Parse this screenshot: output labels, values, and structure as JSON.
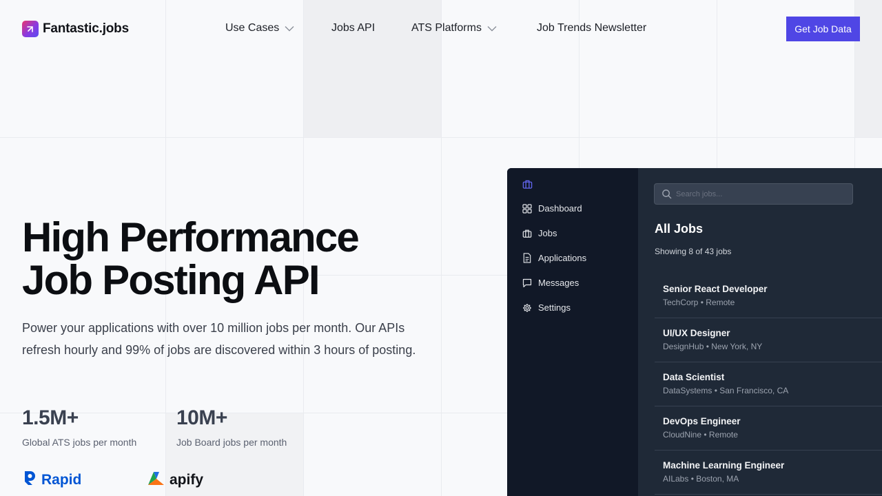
{
  "header": {
    "logo_text": "Fantastic.jobs",
    "nav": [
      {
        "label": "Use Cases",
        "has_dropdown": true
      },
      {
        "label": "Jobs API",
        "has_dropdown": false
      },
      {
        "label": "ATS Platforms",
        "has_dropdown": true
      },
      {
        "label": "Job Trends Newsletter",
        "has_dropdown": false
      }
    ],
    "cta_label": "Get Job Data"
  },
  "hero": {
    "title_line1": "High Performance",
    "title_line2": "Job Posting API",
    "description": "Power your applications with over 10 million jobs per month. Our APIs refresh hourly and 99% of jobs are discovered within 3 hours of posting.",
    "stats": [
      {
        "value": "1.5M+",
        "label": "Global ATS jobs per month"
      },
      {
        "value": "10M+",
        "label": "Job Board jobs per month"
      }
    ],
    "partners": [
      {
        "name": "Rapid",
        "icon": "rapid-logo-icon",
        "color": "#0055d4"
      },
      {
        "name": "apify",
        "icon": "apify-logo-icon",
        "color": "#111318"
      }
    ]
  },
  "app": {
    "sidebar": [
      {
        "label": "Dashboard",
        "icon": "dashboard-icon"
      },
      {
        "label": "Jobs",
        "icon": "briefcase-icon"
      },
      {
        "label": "Applications",
        "icon": "document-icon"
      },
      {
        "label": "Messages",
        "icon": "message-icon"
      },
      {
        "label": "Settings",
        "icon": "gear-icon"
      }
    ],
    "search_placeholder": "Search jobs...",
    "title": "All Jobs",
    "subtitle": "Showing 8 of 43 jobs",
    "jobs": [
      {
        "title": "Senior React Developer",
        "meta": "TechCorp • Remote"
      },
      {
        "title": "UI/UX Designer",
        "meta": "DesignHub • New York, NY"
      },
      {
        "title": "Data Scientist",
        "meta": "DataSystems • San Francisco, CA"
      },
      {
        "title": "DevOps Engineer",
        "meta": "CloudNine • Remote"
      },
      {
        "title": "Machine Learning Engineer",
        "meta": "AILabs • Boston, MA"
      }
    ]
  },
  "colors": {
    "accent": "#4f46e5",
    "app_bg": "#1f2937",
    "app_sidebar_bg": "#111827"
  }
}
